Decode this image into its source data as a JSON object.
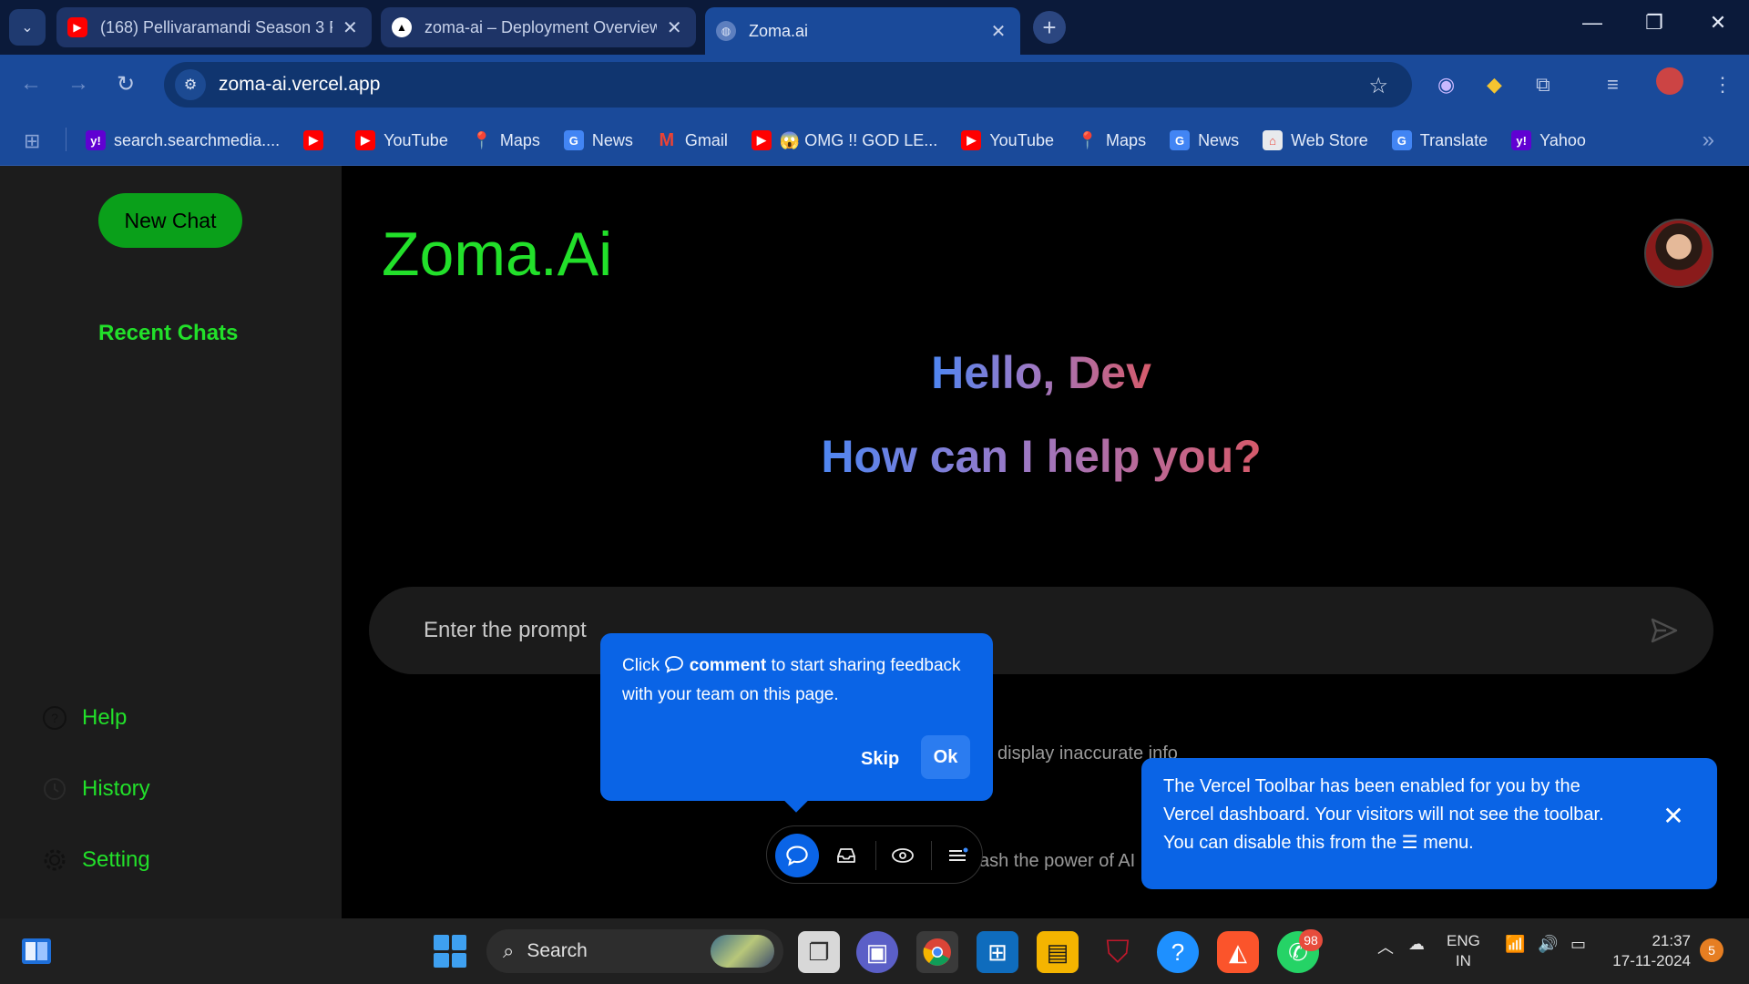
{
  "browser": {
    "tabs": [
      {
        "title": "(168) Pellivaramandi Season 3 F",
        "icon": "youtube-icon"
      },
      {
        "title": "zoma-ai – Deployment Overview",
        "icon": "vercel-icon"
      },
      {
        "title": "Zoma.ai",
        "icon": "globe-icon"
      }
    ],
    "url": "zoma-ai.vercel.app",
    "bookmarks": [
      {
        "label": "search.searchmedia....",
        "icon": "yahoo-icon"
      },
      {
        "label": "",
        "icon": "youtube-icon"
      },
      {
        "label": "YouTube",
        "icon": "youtube-icon"
      },
      {
        "label": "Maps",
        "icon": "maps-icon"
      },
      {
        "label": "News",
        "icon": "news-icon"
      },
      {
        "label": "Gmail",
        "icon": "gmail-icon"
      },
      {
        "label": "😱 OMG !! GOD LE...",
        "icon": "youtube-icon"
      },
      {
        "label": "YouTube",
        "icon": "youtube-icon"
      },
      {
        "label": "Maps",
        "icon": "maps-icon"
      },
      {
        "label": "News",
        "icon": "news-icon"
      },
      {
        "label": "Web Store",
        "icon": "webstore-icon"
      },
      {
        "label": "Translate",
        "icon": "translate-icon"
      },
      {
        "label": "Yahoo",
        "icon": "yahoo-icon"
      }
    ]
  },
  "sidebar": {
    "new_chat": "New Chat",
    "recent_title": "Recent Chats",
    "items": [
      {
        "label": "Help",
        "icon": "help-icon"
      },
      {
        "label": "History",
        "icon": "history-icon"
      },
      {
        "label": "Setting",
        "icon": "gear-icon"
      }
    ]
  },
  "main": {
    "logo": "Zoma.Ai",
    "greeting_1": "Hello, Dev",
    "greeting_2": "How can I help you?",
    "prompt_placeholder": "Enter the prompt",
    "disclaimer_fragment": "display inaccurate info",
    "tagline_fragment": "ash the power of AI"
  },
  "comment_popup": {
    "text_before": "Click",
    "text_bold": "comment",
    "text_after": "to start sharing feedback with your team on this page.",
    "skip": "Skip",
    "ok": "Ok"
  },
  "vercel_toast": {
    "text_main": "The Vercel Toolbar has been enabled for you by the Vercel dashboard. Your visitors will not see the toolbar. You can disable this from the",
    "text_end": "menu."
  },
  "taskbar": {
    "search": "Search",
    "whatsapp_badge": "98",
    "language_line1": "ENG",
    "language_line2": "IN",
    "time": "21:37",
    "date": "17-11-2024",
    "notifications": "5"
  },
  "colors": {
    "accent_green": "#22e02a",
    "button_green": "#0aa01a",
    "vercel_blue": "#0a64e6",
    "chrome_blue": "#1a4a9a"
  }
}
